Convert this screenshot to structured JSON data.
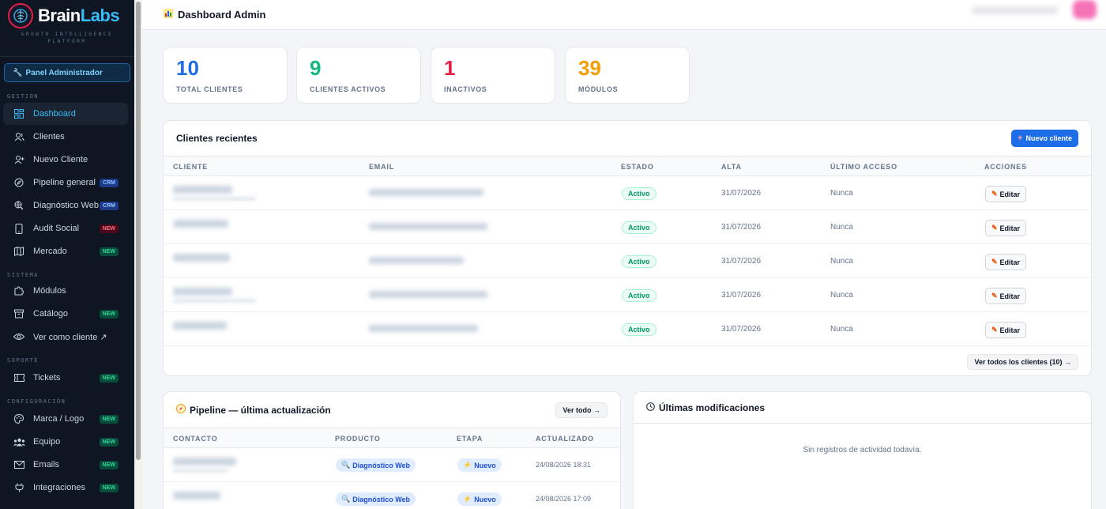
{
  "brand": {
    "name_a": "Brain",
    "name_b": "Labs",
    "tagline_1": "GROWTH INTELLIGENCE",
    "tagline_2": "PLATFORM"
  },
  "sidebar": {
    "admin_button": "Panel Administrador",
    "sections": {
      "gestion": "GESTIÓN",
      "sistema": "SISTEMA",
      "soporte": "SOPORTE",
      "configuracion": "CONFIGURACIÓN"
    },
    "items": [
      {
        "label": "Dashboard",
        "icon": "grid-icon"
      },
      {
        "label": "Clientes",
        "icon": "users-icon"
      },
      {
        "label": "Nuevo Cliente",
        "icon": "user-plus-icon"
      },
      {
        "label": "Pipeline general",
        "icon": "compass-icon",
        "badge": "CRM"
      },
      {
        "label": "Diagnóstico Web",
        "icon": "web-search-icon",
        "badge": "CRM"
      },
      {
        "label": "Audit Social",
        "icon": "phone-icon",
        "badge": "NEW"
      },
      {
        "label": "Mercado",
        "icon": "map-icon",
        "badge": "NEW"
      },
      {
        "label": "Módulos",
        "icon": "puzzle-icon"
      },
      {
        "label": "Catálogo",
        "icon": "archive-icon",
        "badge": "NEW"
      },
      {
        "label": "Ver como cliente ↗",
        "icon": "eye-icon"
      },
      {
        "label": "Tickets",
        "icon": "ticket-icon",
        "badge": "NEW"
      },
      {
        "label": "Marca / Logo",
        "icon": "palette-icon",
        "badge": "NEW"
      },
      {
        "label": "Equipo",
        "icon": "team-icon",
        "badge": "NEW"
      },
      {
        "label": "Emails",
        "icon": "mail-icon",
        "badge": "NEW"
      },
      {
        "label": "Integraciones",
        "icon": "plug-icon",
        "badge": "NEW"
      }
    ]
  },
  "header": {
    "title": "Dashboard Admin"
  },
  "stats": [
    {
      "value": "10",
      "label": "TOTAL CLIENTES",
      "color": "#1d6ce8"
    },
    {
      "value": "9",
      "label": "CLIENTES ACTIVOS",
      "color": "#10b981"
    },
    {
      "value": "1",
      "label": "INACTIVOS",
      "color": "#e11d48"
    },
    {
      "value": "39",
      "label": "MÓDULOS",
      "color": "#f59e0b"
    }
  ],
  "recent_clients": {
    "title": "Clientes recientes",
    "new_button": "Nuevo cliente",
    "columns": [
      "CLIENTE",
      "EMAIL",
      "ESTADO",
      "ALTA",
      "ÚLTIMO ACCESO",
      "ACCIONES"
    ],
    "rows": [
      {
        "status": "Activo",
        "date": "31/07/2026",
        "last_access": "Nunca",
        "action": "Editar"
      },
      {
        "status": "Activo",
        "date": "31/07/2026",
        "last_access": "Nunca",
        "action": "Editar"
      },
      {
        "status": "Activo",
        "date": "31/07/2026",
        "last_access": "Nunca",
        "action": "Editar"
      },
      {
        "status": "Activo",
        "date": "31/07/2026",
        "last_access": "Nunca",
        "action": "Editar"
      },
      {
        "status": "Activo",
        "date": "31/07/2026",
        "last_access": "Nunca",
        "action": "Editar"
      }
    ],
    "view_all": "Ver todos los clientes (10) →"
  },
  "pipeline": {
    "title": "Pipeline — última actualización",
    "view_all": "Ver todo →",
    "columns": [
      "CONTACTO",
      "PRODUCTO",
      "ETAPA",
      "ACTUALIZADO"
    ],
    "rows": [
      {
        "product": "Diagnóstico Web",
        "stage": "Nuevo",
        "updated": "24/08/2026 18:31"
      },
      {
        "product": "Diagnóstico Web",
        "stage": "Nuevo",
        "updated": "24/08/2026 17:09"
      }
    ]
  },
  "activity": {
    "title": "Últimas modificaciones",
    "empty": "Sin registros de actividad todavía."
  }
}
